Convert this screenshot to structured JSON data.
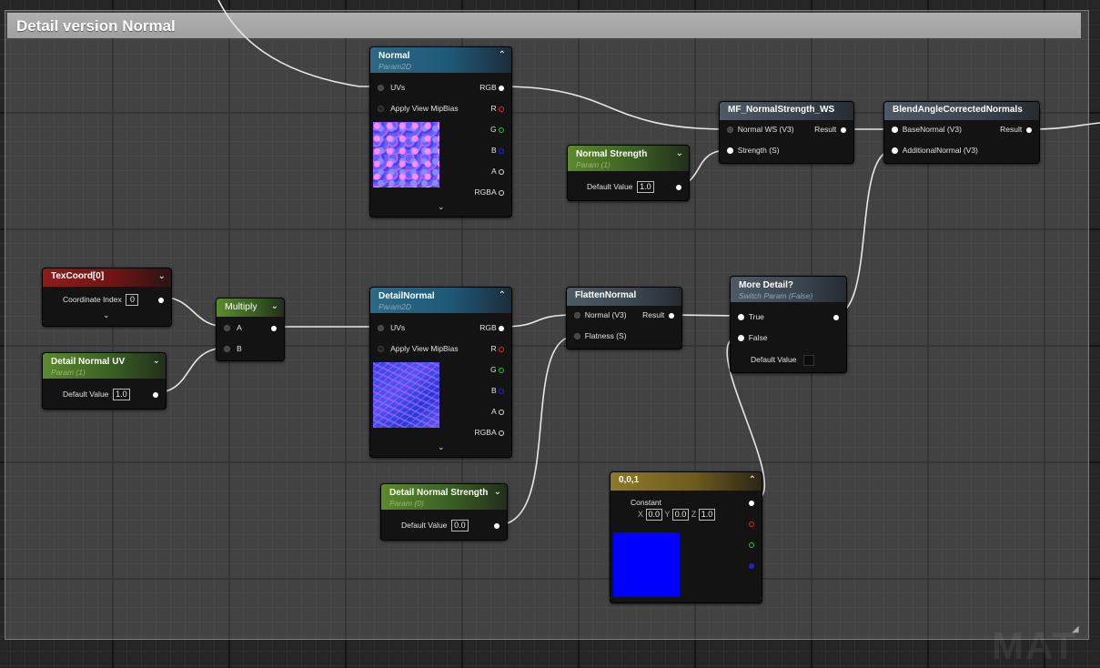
{
  "comment": {
    "title": "Detail version Normal"
  },
  "watermark": "MAT",
  "colors": {
    "constant_swatch": "#0000ff",
    "comment_bg": "#9e9e9e"
  },
  "nodes": {
    "normal": {
      "title": "Normal",
      "subtitle": "Param2D",
      "inputs": [
        "UVs",
        "Apply View MipBias"
      ],
      "outputs": [
        "RGB",
        "R",
        "G",
        "B",
        "A",
        "RGBA"
      ]
    },
    "detail_normal": {
      "title": "DetailNormal",
      "subtitle": "Param2D",
      "inputs": [
        "UVs",
        "Apply View MipBias"
      ],
      "outputs": [
        "RGB",
        "R",
        "G",
        "B",
        "A",
        "RGBA"
      ]
    },
    "normal_strength": {
      "title": "Normal Strength",
      "subtitle": "Param (1)",
      "field_label": "Default Value",
      "value": "1.0"
    },
    "mf_normal_strength": {
      "title": "MF_NormalStrength_WS",
      "inputs": [
        "Normal WS (V3)",
        "Strength (S)"
      ],
      "output": "Result"
    },
    "blend": {
      "title": "BlendAngleCorrectedNormals",
      "inputs": [
        "BaseNormal (V3)",
        "AdditionalNormal (V3)"
      ],
      "output": "Result"
    },
    "texcoord": {
      "title": "TexCoord[0]",
      "field_label": "Coordinate Index",
      "value": "0"
    },
    "detail_normal_uv": {
      "title": "Detail Normal UV",
      "subtitle": "Param (1)",
      "field_label": "Default Value",
      "value": "1.0"
    },
    "multiply": {
      "title": "Multiply",
      "inputs": [
        "A",
        "B"
      ]
    },
    "flatten_normal": {
      "title": "FlattenNormal",
      "inputs": [
        "Normal (V3)",
        "Flatness (S)"
      ],
      "output": "Result"
    },
    "more_detail": {
      "title": "More Detail?",
      "subtitle": "Switch Param (False)",
      "inputs": [
        "True",
        "False"
      ],
      "field_label": "Default Value"
    },
    "detail_normal_strength": {
      "title": "Detail Normal Strength",
      "subtitle": "Param (0)",
      "field_label": "Default Value",
      "value": "0.0"
    },
    "constant": {
      "title": "0,0,1",
      "label": "Constant",
      "x_label": "X",
      "x": "0.0",
      "y_label": "Y",
      "y": "0.0",
      "z_label": "Z",
      "z": "1.0"
    }
  }
}
